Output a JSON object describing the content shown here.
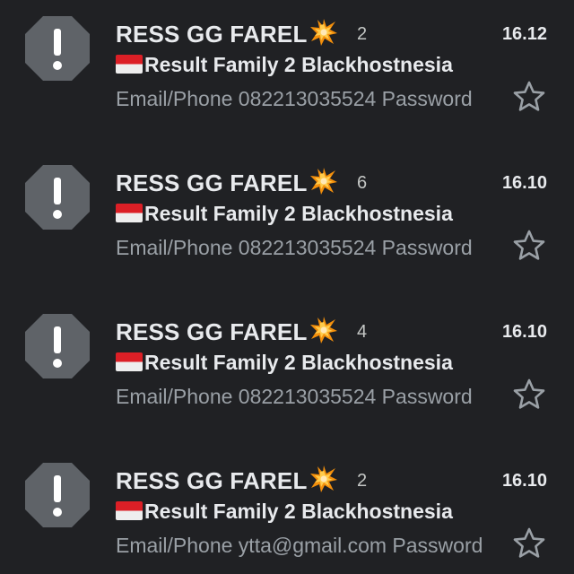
{
  "theme": {
    "background": "#202124",
    "avatar_color": "#5f6368",
    "primary_text": "#e8eaed",
    "secondary_text": "#9aa0a6",
    "star_outline": "#9aa0a6"
  },
  "emails": [
    {
      "sender": "RESS GG FAREL",
      "sender_emoji": "collision-emoji",
      "count": "2",
      "time": "16.12",
      "subject_flag": "indonesia-flag-emoji",
      "subject": "Result Family 2 Blackhostnesia",
      "snippet": "Email/Phone 082213035524 Password",
      "starred": false,
      "avatar_icon": "warning-octagon-icon"
    },
    {
      "sender": "RESS GG FAREL",
      "sender_emoji": "collision-emoji",
      "count": "6",
      "time": "16.10",
      "subject_flag": "indonesia-flag-emoji",
      "subject": "Result Family 2 Blackhostnesia",
      "snippet": "Email/Phone 082213035524 Password",
      "starred": false,
      "avatar_icon": "warning-octagon-icon"
    },
    {
      "sender": "RESS GG FAREL",
      "sender_emoji": "collision-emoji",
      "count": "4",
      "time": "16.10",
      "subject_flag": "indonesia-flag-emoji",
      "subject": "Result Family 2 Blackhostnesia",
      "snippet": "Email/Phone 082213035524 Password",
      "starred": false,
      "avatar_icon": "warning-octagon-icon"
    },
    {
      "sender": "RESS GG FAREL",
      "sender_emoji": "collision-emoji",
      "count": "2",
      "time": "16.10",
      "subject_flag": "indonesia-flag-emoji",
      "subject": "Result Family 2 Blackhostnesia",
      "snippet": "Email/Phone ytta@gmail.com Password",
      "starred": false,
      "avatar_icon": "warning-octagon-icon"
    }
  ]
}
